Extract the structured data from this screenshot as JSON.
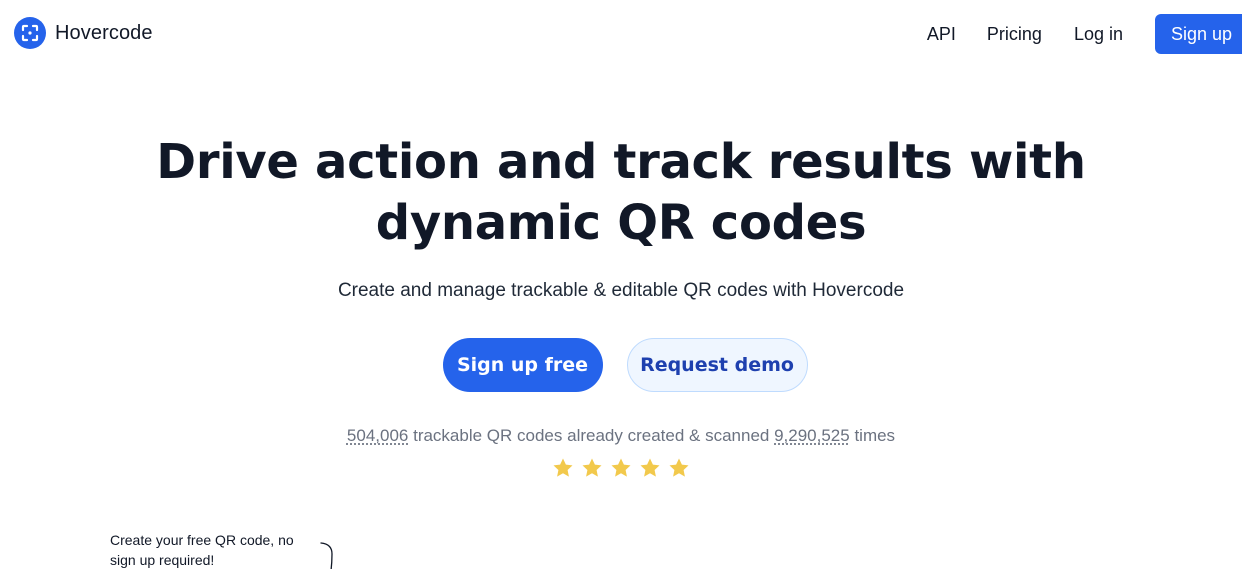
{
  "brand": {
    "name": "Hovercode",
    "logo_icon": "qr-frame-logo-icon",
    "color": "#2563eb"
  },
  "nav": {
    "api": "API",
    "pricing": "Pricing",
    "login": "Log in",
    "signup": "Sign up"
  },
  "hero": {
    "title_line1": "Drive action and track results with",
    "title_line2": "dynamic QR codes",
    "subtitle": "Create and manage trackable & editable QR codes with Hovercode",
    "cta_primary": "Sign up free",
    "cta_secondary": "Request demo"
  },
  "stats": {
    "created_count": "504,006",
    "created_text": " trackable QR codes already created & scanned ",
    "scanned_count": "9,290,525",
    "suffix": " times"
  },
  "rating": {
    "stars": 5,
    "star_color": "#f2c94c",
    "star_icon": "star-icon"
  },
  "note": {
    "text": "Create your free QR code, no sign up required!",
    "arrow_icon": "curved-arrow-icon"
  }
}
